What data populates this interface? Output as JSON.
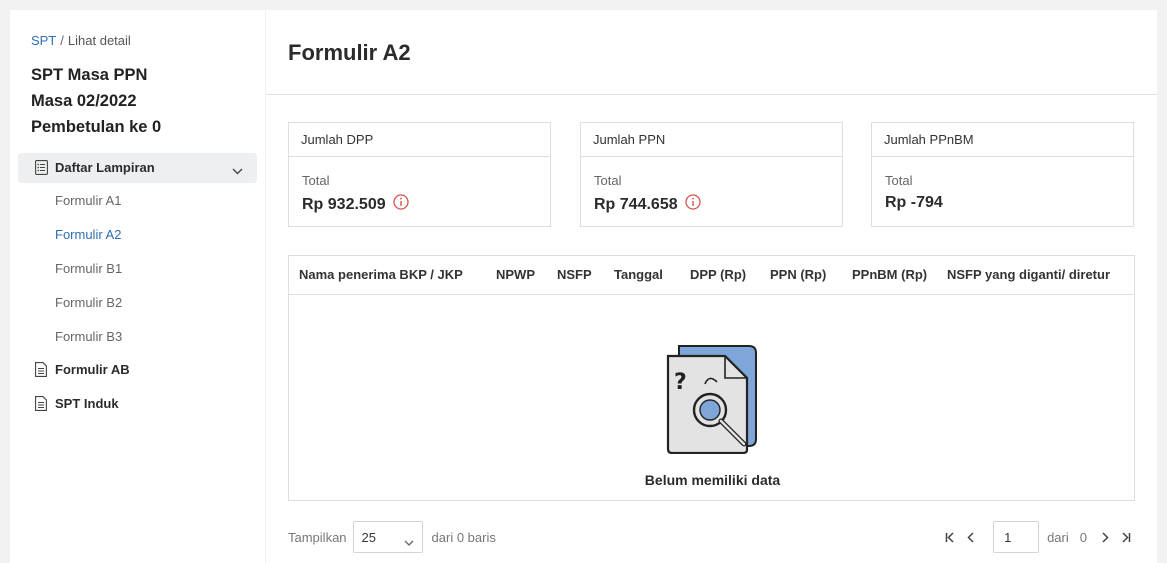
{
  "breadcrumb": {
    "root": "SPT",
    "separator": "/",
    "current": "Lihat detail"
  },
  "sidebar": {
    "title_line1": "SPT Masa PPN",
    "title_line2": "Masa 02/2022",
    "title_line3": "Pembetulan ke 0",
    "group_label": "Daftar Lampiran",
    "group_icon": "document-list-icon",
    "sub_items": [
      "Formulir A1",
      "Formulir A2",
      "Formulir B1",
      "Formulir B2",
      "Formulir B3"
    ],
    "active_item": "Formulir A2",
    "items": [
      {
        "label": "Formulir AB",
        "icon": "document-icon"
      },
      {
        "label": "SPT Induk",
        "icon": "document-icon"
      }
    ]
  },
  "page": {
    "title": "Formulir A2"
  },
  "cards": [
    {
      "header": "Jumlah DPP",
      "label": "Total",
      "value": "Rp 932.509",
      "has_info_icon": true
    },
    {
      "header": "Jumlah PPN",
      "label": "Total",
      "value": "Rp 744.658",
      "has_info_icon": true
    },
    {
      "header": "Jumlah PPnBM",
      "label": "Total",
      "value": "Rp -794",
      "has_info_icon": false
    }
  ],
  "table": {
    "columns": [
      "Nama penerima BKP / JKP",
      "NPWP",
      "NSFP",
      "Tanggal",
      "DPP (Rp)",
      "PPN (Rp)",
      "PPnBM (Rp)",
      "NSFP yang diganti/ diretur"
    ],
    "rows": [],
    "empty_text": "Belum memiliki data",
    "empty_icon": "empty-document-search-icon"
  },
  "pagination": {
    "show_label": "Tampilkan",
    "page_size": "25",
    "rows_text": "dari 0 baris",
    "page_value": "1",
    "of_label": "dari",
    "total_pages": "0"
  },
  "colors": {
    "accent": "#2f6fb3",
    "info_icon": "#d9534f",
    "illustration_blue": "#7fa6d9"
  }
}
